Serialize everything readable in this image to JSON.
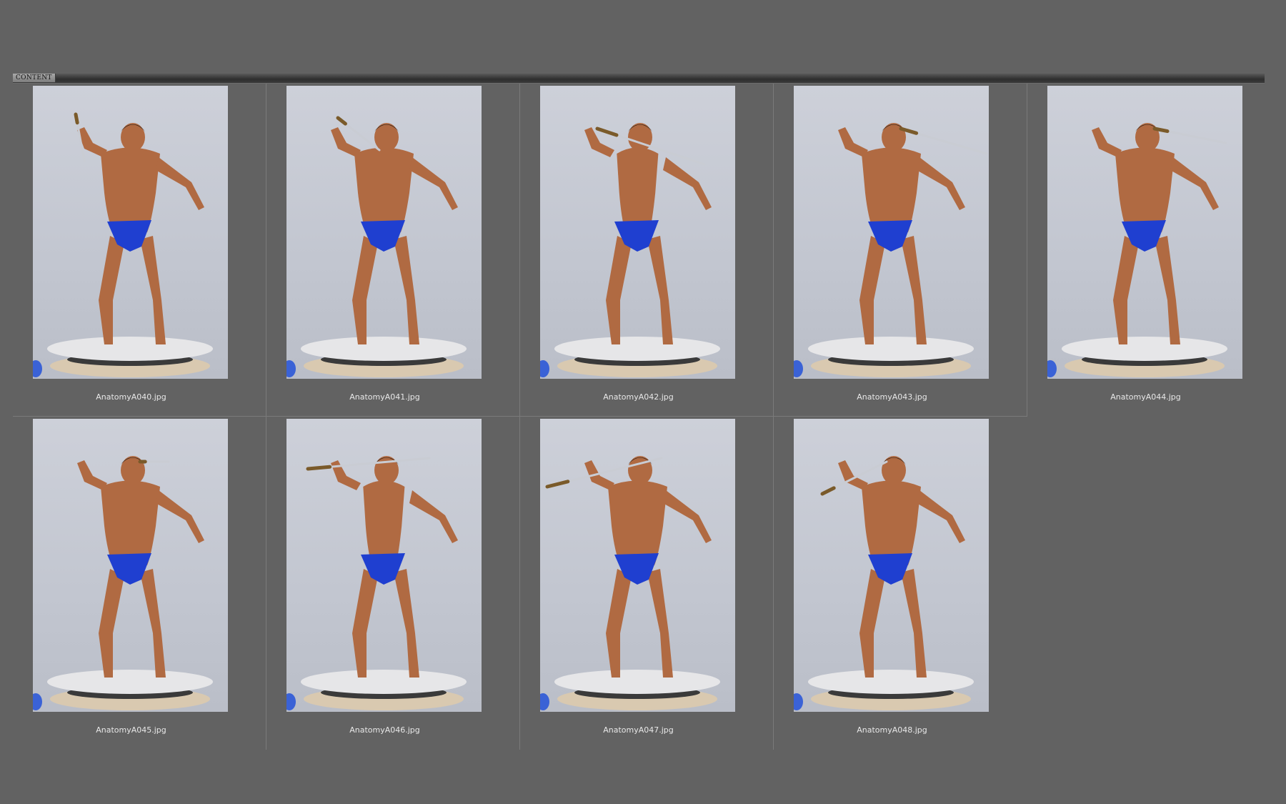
{
  "panel": {
    "tab_label": "CONTENT"
  },
  "items": [
    {
      "filename": "AnatomyA040.jpg",
      "view": "front"
    },
    {
      "filename": "AnatomyA041.jpg",
      "view": "front"
    },
    {
      "filename": "AnatomyA042.jpg",
      "view": "side"
    },
    {
      "filename": "AnatomyA043.jpg",
      "view": "back"
    },
    {
      "filename": "AnatomyA044.jpg",
      "view": "back"
    },
    {
      "filename": "AnatomyA045.jpg",
      "view": "back"
    },
    {
      "filename": "AnatomyA046.jpg",
      "view": "side"
    },
    {
      "filename": "AnatomyA047.jpg",
      "view": "front"
    },
    {
      "filename": "AnatomyA048.jpg",
      "view": "front"
    }
  ],
  "colors": {
    "background": "#626262",
    "photo_backdrop": "#c6c9d3",
    "skin": "#b06a42",
    "trunks": "#1f3fd0",
    "turntable": "#e6e6e8",
    "sword_blade": "#c9ccd3",
    "sword_hilt": "#7a5a2a"
  }
}
